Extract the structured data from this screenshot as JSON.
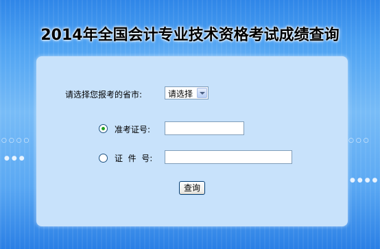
{
  "header": {
    "title": "2014年全国会计专业技术资格考试成绩查询"
  },
  "form": {
    "province_label": "请选择您报考的省市:",
    "province_select": {
      "selected": "请选择"
    },
    "exam_number": {
      "label": "准考证号:",
      "value": "",
      "checked": true
    },
    "id_number": {
      "label": "证  件  号:",
      "value": "",
      "checked": false
    },
    "query_button": "查询"
  },
  "colors": {
    "background": "#5aa8f3",
    "panel": "#c8e2fb",
    "radio_selected": "#21a121"
  }
}
